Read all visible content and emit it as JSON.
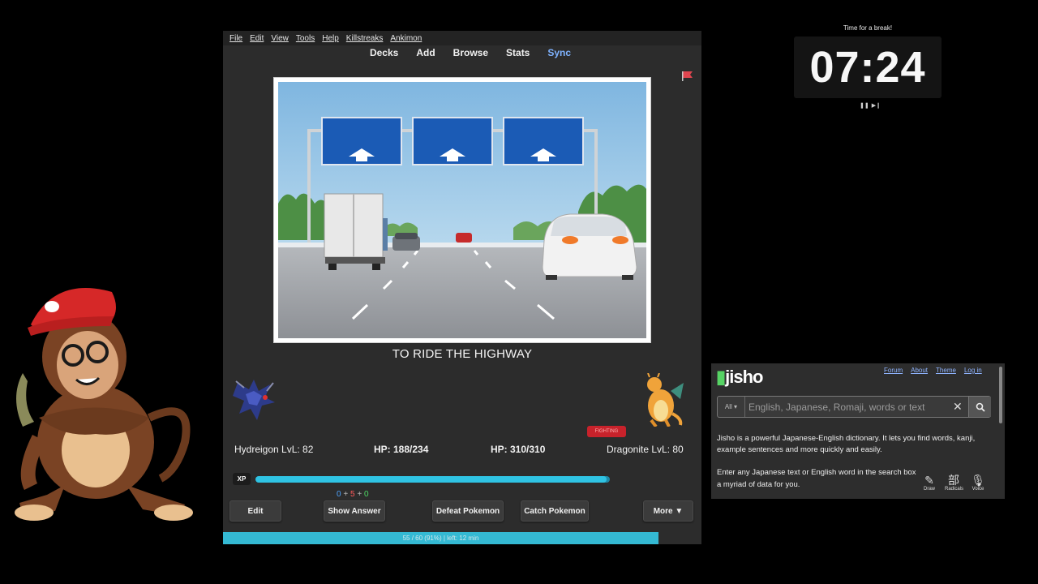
{
  "anki": {
    "menu": [
      "File",
      "Edit",
      "View",
      "Tools",
      "Help",
      "Killstreaks",
      "Ankimon"
    ],
    "toolbar": [
      "Decks",
      "Add",
      "Browse",
      "Stats",
      "Sync"
    ],
    "question": "TO RIDE THE HIGHWAY",
    "battle": {
      "player_name": "Hydreigon LvL: 82",
      "player_hp": "HP: 188/234",
      "enemy_hp": "HP: 310/310",
      "enemy_name": "Dragonite LvL: 80",
      "type_badge": "FIGHTING"
    },
    "xp_label": "XP",
    "xp_fraction": 0.99,
    "counts": {
      "new": "0",
      "learn": "5",
      "review": "0"
    },
    "buttons": {
      "edit": "Edit",
      "show_answer": "Show Answer",
      "defeat": "Defeat Pokemon",
      "catch": "Catch Pokemon",
      "more": "More ▼"
    },
    "progress": {
      "text": "55 / 60 (91%) | left: 12 min",
      "fraction": 0.91
    }
  },
  "timer": {
    "caption": "Time for a break!",
    "time": "07:24",
    "controls": [
      "pause-icon",
      "skip-icon"
    ]
  },
  "jisho": {
    "logo": "jisho",
    "nav": [
      "Forum",
      "About",
      "Theme",
      "Log in"
    ],
    "filter": "All ▾",
    "search_placeholder": "English, Japanese, Romaji, words or text",
    "intro": "Jisho is a powerful Japanese-English dictionary. It lets you find words, kanji, example sentences and more quickly and easily.",
    "enter_text": "Enter any Japanese text or English word in the search box",
    "enter_text_tail": "a myriad of data for you.",
    "tools": [
      {
        "icon": "✎",
        "label": "Draw"
      },
      {
        "icon": "部",
        "label": "Radicals"
      },
      {
        "icon": "🎙",
        "label": "Voice"
      }
    ]
  },
  "colors": {
    "accent": "#2fc3e3",
    "sync": "#7fb3ff",
    "flag": "#e0454f",
    "jisho_green": "#56d364"
  }
}
